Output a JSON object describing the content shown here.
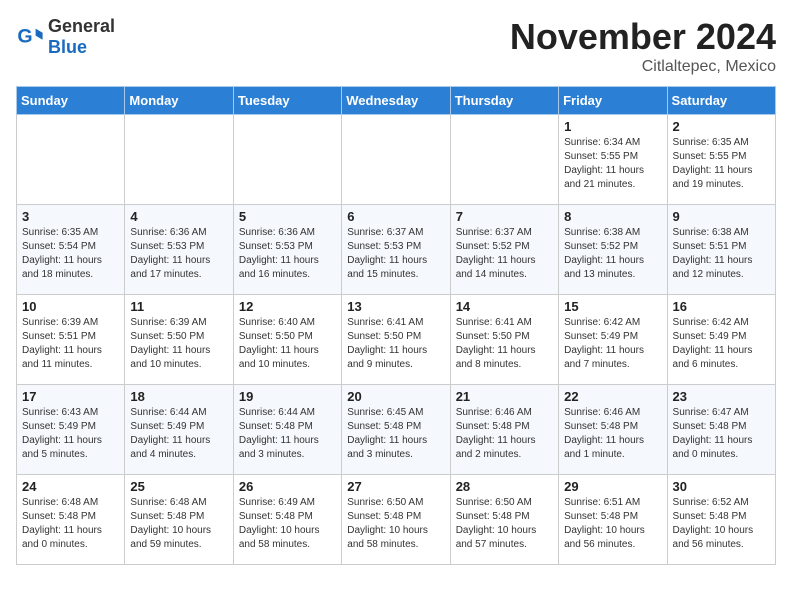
{
  "header": {
    "logo_general": "General",
    "logo_blue": "Blue",
    "month_title": "November 2024",
    "location": "Citlaltepec, Mexico"
  },
  "days_of_week": [
    "Sunday",
    "Monday",
    "Tuesday",
    "Wednesday",
    "Thursday",
    "Friday",
    "Saturday"
  ],
  "weeks": [
    [
      {
        "day": "",
        "info": ""
      },
      {
        "day": "",
        "info": ""
      },
      {
        "day": "",
        "info": ""
      },
      {
        "day": "",
        "info": ""
      },
      {
        "day": "",
        "info": ""
      },
      {
        "day": "1",
        "info": "Sunrise: 6:34 AM\nSunset: 5:55 PM\nDaylight: 11 hours and 21 minutes."
      },
      {
        "day": "2",
        "info": "Sunrise: 6:35 AM\nSunset: 5:55 PM\nDaylight: 11 hours and 19 minutes."
      }
    ],
    [
      {
        "day": "3",
        "info": "Sunrise: 6:35 AM\nSunset: 5:54 PM\nDaylight: 11 hours and 18 minutes."
      },
      {
        "day": "4",
        "info": "Sunrise: 6:36 AM\nSunset: 5:53 PM\nDaylight: 11 hours and 17 minutes."
      },
      {
        "day": "5",
        "info": "Sunrise: 6:36 AM\nSunset: 5:53 PM\nDaylight: 11 hours and 16 minutes."
      },
      {
        "day": "6",
        "info": "Sunrise: 6:37 AM\nSunset: 5:53 PM\nDaylight: 11 hours and 15 minutes."
      },
      {
        "day": "7",
        "info": "Sunrise: 6:37 AM\nSunset: 5:52 PM\nDaylight: 11 hours and 14 minutes."
      },
      {
        "day": "8",
        "info": "Sunrise: 6:38 AM\nSunset: 5:52 PM\nDaylight: 11 hours and 13 minutes."
      },
      {
        "day": "9",
        "info": "Sunrise: 6:38 AM\nSunset: 5:51 PM\nDaylight: 11 hours and 12 minutes."
      }
    ],
    [
      {
        "day": "10",
        "info": "Sunrise: 6:39 AM\nSunset: 5:51 PM\nDaylight: 11 hours and 11 minutes."
      },
      {
        "day": "11",
        "info": "Sunrise: 6:39 AM\nSunset: 5:50 PM\nDaylight: 11 hours and 10 minutes."
      },
      {
        "day": "12",
        "info": "Sunrise: 6:40 AM\nSunset: 5:50 PM\nDaylight: 11 hours and 10 minutes."
      },
      {
        "day": "13",
        "info": "Sunrise: 6:41 AM\nSunset: 5:50 PM\nDaylight: 11 hours and 9 minutes."
      },
      {
        "day": "14",
        "info": "Sunrise: 6:41 AM\nSunset: 5:50 PM\nDaylight: 11 hours and 8 minutes."
      },
      {
        "day": "15",
        "info": "Sunrise: 6:42 AM\nSunset: 5:49 PM\nDaylight: 11 hours and 7 minutes."
      },
      {
        "day": "16",
        "info": "Sunrise: 6:42 AM\nSunset: 5:49 PM\nDaylight: 11 hours and 6 minutes."
      }
    ],
    [
      {
        "day": "17",
        "info": "Sunrise: 6:43 AM\nSunset: 5:49 PM\nDaylight: 11 hours and 5 minutes."
      },
      {
        "day": "18",
        "info": "Sunrise: 6:44 AM\nSunset: 5:49 PM\nDaylight: 11 hours and 4 minutes."
      },
      {
        "day": "19",
        "info": "Sunrise: 6:44 AM\nSunset: 5:48 PM\nDaylight: 11 hours and 3 minutes."
      },
      {
        "day": "20",
        "info": "Sunrise: 6:45 AM\nSunset: 5:48 PM\nDaylight: 11 hours and 3 minutes."
      },
      {
        "day": "21",
        "info": "Sunrise: 6:46 AM\nSunset: 5:48 PM\nDaylight: 11 hours and 2 minutes."
      },
      {
        "day": "22",
        "info": "Sunrise: 6:46 AM\nSunset: 5:48 PM\nDaylight: 11 hours and 1 minute."
      },
      {
        "day": "23",
        "info": "Sunrise: 6:47 AM\nSunset: 5:48 PM\nDaylight: 11 hours and 0 minutes."
      }
    ],
    [
      {
        "day": "24",
        "info": "Sunrise: 6:48 AM\nSunset: 5:48 PM\nDaylight: 11 hours and 0 minutes."
      },
      {
        "day": "25",
        "info": "Sunrise: 6:48 AM\nSunset: 5:48 PM\nDaylight: 10 hours and 59 minutes."
      },
      {
        "day": "26",
        "info": "Sunrise: 6:49 AM\nSunset: 5:48 PM\nDaylight: 10 hours and 58 minutes."
      },
      {
        "day": "27",
        "info": "Sunrise: 6:50 AM\nSunset: 5:48 PM\nDaylight: 10 hours and 58 minutes."
      },
      {
        "day": "28",
        "info": "Sunrise: 6:50 AM\nSunset: 5:48 PM\nDaylight: 10 hours and 57 minutes."
      },
      {
        "day": "29",
        "info": "Sunrise: 6:51 AM\nSunset: 5:48 PM\nDaylight: 10 hours and 56 minutes."
      },
      {
        "day": "30",
        "info": "Sunrise: 6:52 AM\nSunset: 5:48 PM\nDaylight: 10 hours and 56 minutes."
      }
    ]
  ]
}
